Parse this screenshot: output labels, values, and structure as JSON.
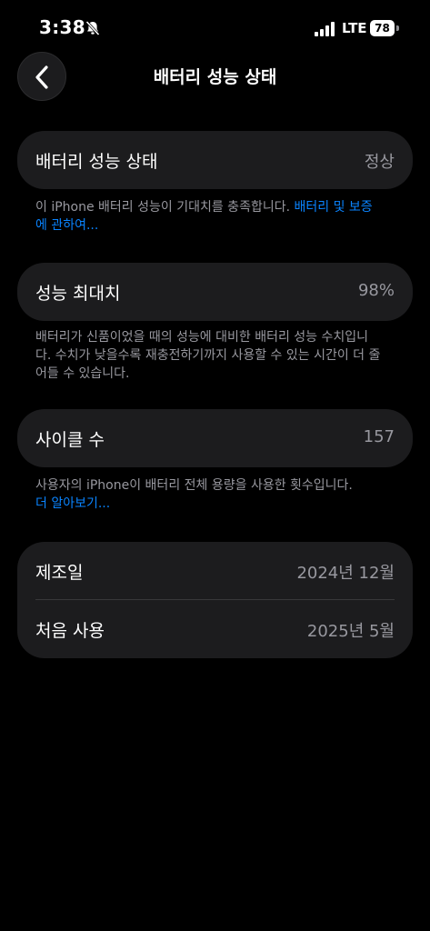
{
  "status_bar": {
    "time": "3:38",
    "carrier": "LTE",
    "battery_level": "78"
  },
  "nav": {
    "title": "배터리 성능 상태"
  },
  "health_card": {
    "label": "배터리 성능 상태",
    "value": "정상"
  },
  "health_footnote": {
    "text": "이 iPhone 배터리 성능이 기대치를 충족합니다. ",
    "link": "배터리 및 보증에 관하여..."
  },
  "capacity_card": {
    "label": "성능 최대치",
    "value": "98%"
  },
  "capacity_footnote": {
    "text": "배터리가 신품이었을 때의 성능에 대비한 배터리 성능 수치입니다. 수치가 낮을수록 재충전하기까지 사용할 수 있는 시간이 더 줄어들 수 있습니다."
  },
  "cycle_card": {
    "label": "사이클 수",
    "value": "157"
  },
  "cycle_footnote": {
    "text": "사용자의 iPhone이 배터리 전체 용량을 사용한 횟수입니다.",
    "link": "더 알아보기..."
  },
  "dates_card": {
    "manufactured_label": "제조일",
    "manufactured_value": "2024년 12월",
    "first_use_label": "처음 사용",
    "first_use_value": "2025년 5월"
  },
  "colors": {
    "background": "#000000",
    "card": "#1c1c1e",
    "secondary_text": "#98989f",
    "link": "#0a84ff"
  },
  "icons": [
    "bell-slash-icon",
    "cellular-signal-icon",
    "battery-icon",
    "chevron-left-icon"
  ]
}
